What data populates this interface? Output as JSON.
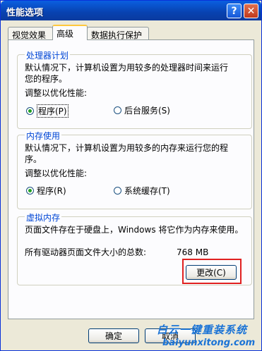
{
  "window": {
    "title": "性能选项",
    "help_label": "?",
    "close_label": "✕"
  },
  "tabs": [
    {
      "label": "视觉效果"
    },
    {
      "label": "高级"
    },
    {
      "label": "数据执行保护"
    }
  ],
  "processor_group": {
    "title": "处理器计划",
    "description_line1": "默认情况下，计算机设置为用较多的处理器时间来运行",
    "description_line2": "您的程序。",
    "adjust_label": "调整以优化性能:",
    "option_programs": "程序(P)",
    "option_background": "后台服务(S)",
    "selected": "程序(P)"
  },
  "memory_group": {
    "title": "内存使用",
    "description_line1": "默认情况下，计算机设置为用较多的内存来运行您的程",
    "description_line2": "序。",
    "adjust_label": "调整以优化性能:",
    "option_programs": "程序(R)",
    "option_cache": "系统缓存(T)",
    "selected": "程序(R)"
  },
  "virtual_memory_group": {
    "title": "虚拟内存",
    "description": "页面文件存在于硬盘上，Windows 将它作为内存来使用。",
    "total_label": "所有驱动器页面文件大小的总数:",
    "total_value": "768 MB",
    "change_button": "更改(C)"
  },
  "footer": {
    "ok_button": "确定",
    "cancel_button": "取消"
  },
  "watermark": {
    "line1": "白云一键重装系统",
    "line2": "baiyunxitong.com"
  }
}
